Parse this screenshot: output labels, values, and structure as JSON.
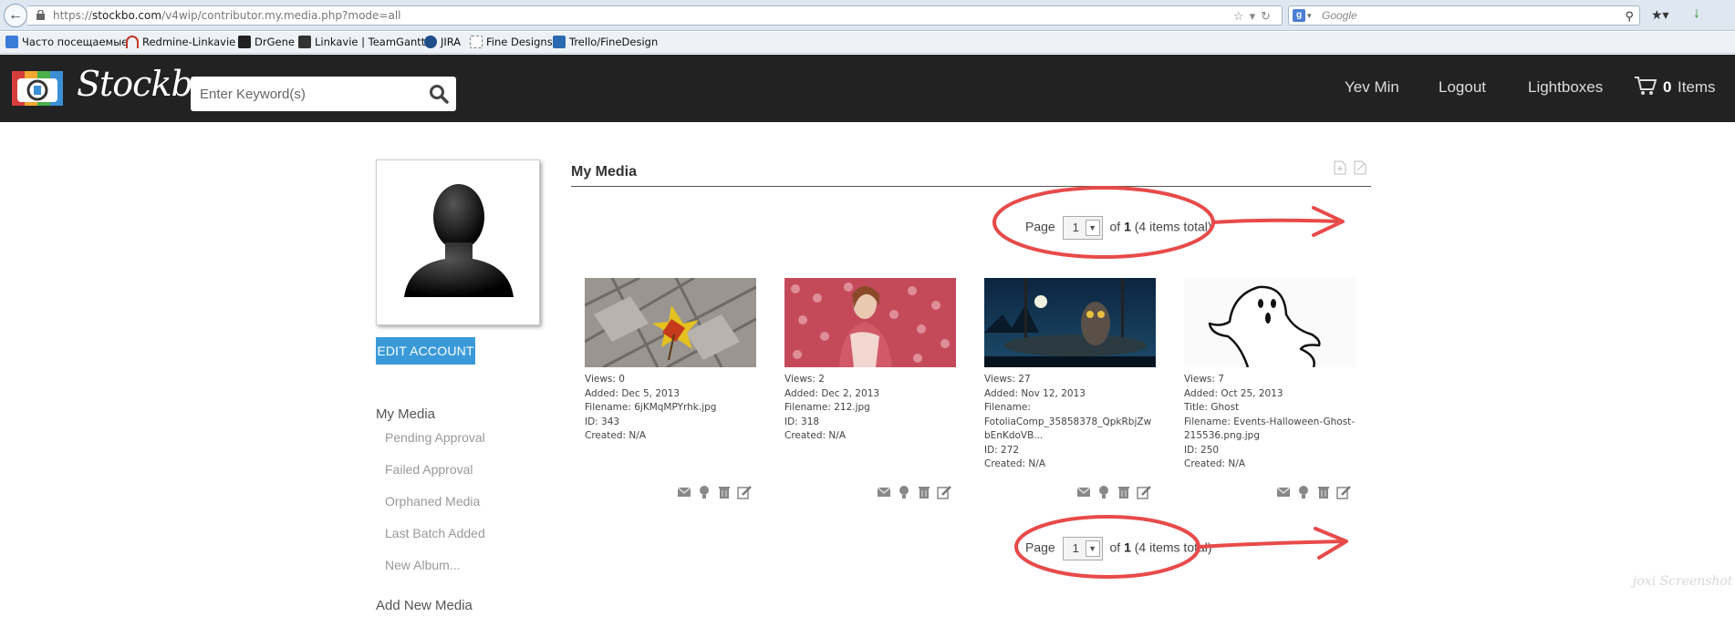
{
  "browser": {
    "url_prefix": "https://",
    "url_host": "stockbo.com",
    "url_path": "/v4wip/contributor.my.media.php?mode=all",
    "search_engine_badge": "g",
    "search_placeholder": "Google"
  },
  "bookmarks": [
    {
      "label": "Часто посещаемые",
      "color": "#3b7dd8"
    },
    {
      "label": "Redmine-Linkavie",
      "color": "#c0392b"
    },
    {
      "label": "DrGene",
      "color": "#222222"
    },
    {
      "label": "Linkavie | TeamGantt",
      "color": "#333333"
    },
    {
      "label": "JIRA",
      "color": "#1f4e8a"
    },
    {
      "label": "Fine Designs",
      "color": "#ffffff"
    },
    {
      "label": "Trello/FineDesign",
      "color": "#2a6ab0"
    }
  ],
  "header": {
    "logo_text": "Stockbo",
    "search_placeholder": "Enter Keyword(s)",
    "nav": [
      "Yev Min",
      "Logout",
      "Lightboxes"
    ],
    "cart_count": "0",
    "cart_label": "Items"
  },
  "sidebar": {
    "edit_account": "EDIT ACCOUNT",
    "heading": "My Media",
    "items": [
      "Pending Approval",
      "Failed Approval",
      "Orphaned Media",
      "Last Batch Added",
      "New Album..."
    ],
    "add_new": "Add New Media"
  },
  "main": {
    "title": "My Media",
    "pager": {
      "page_label": "Page",
      "current_page": "1",
      "of_label": "of",
      "total_pages": "1",
      "total_text": "(4 items total)"
    },
    "items": [
      {
        "views": "Views: 0",
        "added": "Added: Dec 5, 2013",
        "title": "",
        "filename": "Filename: 6jKMqMPYrhk.jpg",
        "id": "ID: 343",
        "created": "Created: N/A"
      },
      {
        "views": "Views: 2",
        "added": "Added: Dec 2, 2013",
        "title": "",
        "filename": "Filename: 212.jpg",
        "id": "ID: 318",
        "created": "Created: N/A"
      },
      {
        "views": "Views: 27",
        "added": "Added: Nov 12, 2013",
        "title": "",
        "filename": "Filename: FotoliaComp_35858378_QpkRbjZwbEnKdoVB...",
        "id": "ID: 272",
        "created": "Created: N/A"
      },
      {
        "views": "Views: 7",
        "added": "Added: Oct 25, 2013",
        "title": "Title: Ghost",
        "filename": "Filename: Events-Halloween-Ghost-215536.png.jpg",
        "id": "ID: 250",
        "created": "Created: N/A"
      }
    ]
  },
  "colors": {
    "header_bg": "#222222",
    "accent_button": "#3a9ad9",
    "annotation_red": "#e84a4a"
  },
  "watermark": "joxi Screenshot"
}
